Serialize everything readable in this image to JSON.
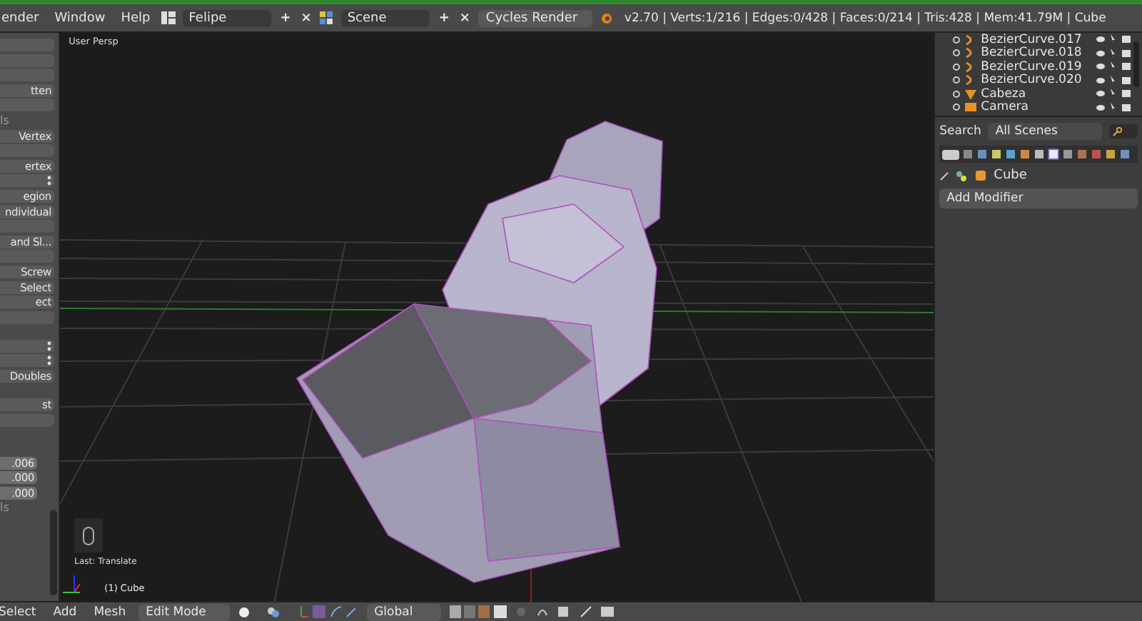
{
  "top_bar": {
    "menus": [
      "ender",
      "Window",
      "Help"
    ],
    "screen_layout": "Felipe",
    "scene": "Scene",
    "render_engine": "Cycles Render",
    "stats": "v2.70 | Verts:1/216 | Edges:0/428 | Faces:0/214 | Tris:428 | Mem:41.79M | Cube",
    "add_label": "+",
    "close_label": "×"
  },
  "tool_shelf": [
    {
      "kind": "button"
    },
    {
      "kind": "button"
    },
    {
      "kind": "button"
    },
    {
      "kind": "button",
      "label": "tten"
    },
    {
      "kind": "button"
    },
    {
      "kind": "label",
      "label": "ls"
    },
    {
      "kind": "button",
      "label": "Vertex"
    },
    {
      "kind": "button"
    },
    {
      "kind": "button",
      "label": "ertex"
    },
    {
      "kind": "dropdown"
    },
    {
      "kind": "button",
      "label": "egion"
    },
    {
      "kind": "button",
      "label": "ndividual"
    },
    {
      "kind": "button"
    },
    {
      "kind": "button",
      "label": "and Sl..."
    },
    {
      "kind": "button"
    },
    {
      "kind": "button",
      "label": "Screw"
    },
    {
      "kind": "button",
      "label": "Select"
    },
    {
      "kind": "button",
      "label": "ect"
    },
    {
      "kind": "button"
    },
    {
      "kind": "spacer"
    },
    {
      "kind": "dropdown"
    },
    {
      "kind": "dropdown"
    },
    {
      "kind": "button",
      "label": "Doubles"
    },
    {
      "kind": "spacer"
    },
    {
      "kind": "button",
      "label": "st"
    },
    {
      "kind": "button"
    },
    {
      "kind": "spacer"
    },
    {
      "kind": "spacer"
    },
    {
      "kind": "number",
      "label": ".006"
    },
    {
      "kind": "number",
      "label": ".000"
    },
    {
      "kind": "number",
      "label": ".000"
    },
    {
      "kind": "label",
      "label": "ls"
    }
  ],
  "viewport": {
    "view_name": "User Persp",
    "last_operator": "Last: Translate",
    "object_info": "(1) Cube"
  },
  "outliner": {
    "rows": [
      {
        "name": "BezierCurve.017",
        "kind": "curve"
      },
      {
        "name": "BezierCurve.018",
        "kind": "curve"
      },
      {
        "name": "BezierCurve.019",
        "kind": "curve"
      },
      {
        "name": "BezierCurve.020",
        "kind": "curve"
      },
      {
        "name": "Cabeza",
        "kind": "mesh"
      },
      {
        "name": "Camera",
        "kind": "camera"
      }
    ]
  },
  "properties": {
    "search_label": "Search",
    "search_scope": "All Scenes",
    "tabs": [
      {
        "selected": false
      },
      {
        "selected": false
      },
      {
        "selected": false
      },
      {
        "selected": false
      },
      {
        "selected": false
      },
      {
        "selected": false
      },
      {
        "selected": true
      },
      {
        "selected": false
      },
      {
        "selected": false
      },
      {
        "selected": false
      },
      {
        "selected": false
      },
      {
        "selected": false
      }
    ],
    "object_name": "Cube",
    "add_modifier": "Add Modifier"
  },
  "bottom_bar": {
    "menus": [
      "Select",
      "Add",
      "Mesh"
    ],
    "mode": "Edit Mode",
    "orientation": "Global"
  }
}
